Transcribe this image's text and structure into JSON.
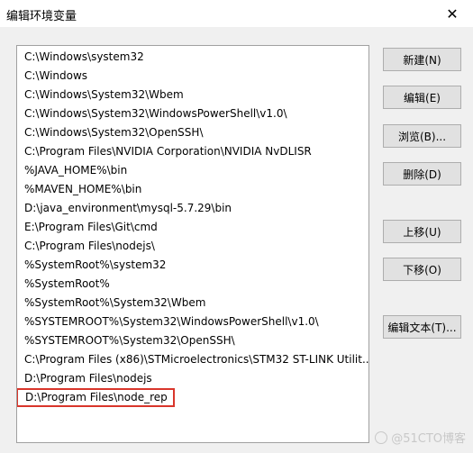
{
  "window": {
    "title": "编辑环境变量",
    "close_glyph": "✕"
  },
  "path_list": {
    "items": [
      "C:\\Windows\\system32",
      "C:\\Windows",
      "C:\\Windows\\System32\\Wbem",
      "C:\\Windows\\System32\\WindowsPowerShell\\v1.0\\",
      "C:\\Windows\\System32\\OpenSSH\\",
      "C:\\Program Files\\NVIDIA Corporation\\NVIDIA NvDLISR",
      "%JAVA_HOME%\\bin",
      "%MAVEN_HOME%\\bin",
      "D:\\java_environment\\mysql-5.7.29\\bin",
      "E:\\Program Files\\Git\\cmd",
      "C:\\Program Files\\nodejs\\",
      "%SystemRoot%\\system32",
      "%SystemRoot%",
      "%SystemRoot%\\System32\\Wbem",
      "%SYSTEMROOT%\\System32\\WindowsPowerShell\\v1.0\\",
      "%SYSTEMROOT%\\System32\\OpenSSH\\",
      "C:\\Program Files (x86)\\STMicroelectronics\\STM32 ST-LINK Utilit...",
      "D:\\Program Files\\nodejs",
      "D:\\Program Files\\node_rep"
    ],
    "highlighted_index": 18,
    "highlight_color": "#d9362b"
  },
  "buttons": {
    "new": "新建(N)",
    "edit": "编辑(E)",
    "browse": "浏览(B)...",
    "delete": "删除(D)",
    "move_up": "上移(U)",
    "move_down": "下移(O)",
    "edit_text": "编辑文本(T)..."
  },
  "watermark": {
    "text": "@51CTO博客"
  }
}
